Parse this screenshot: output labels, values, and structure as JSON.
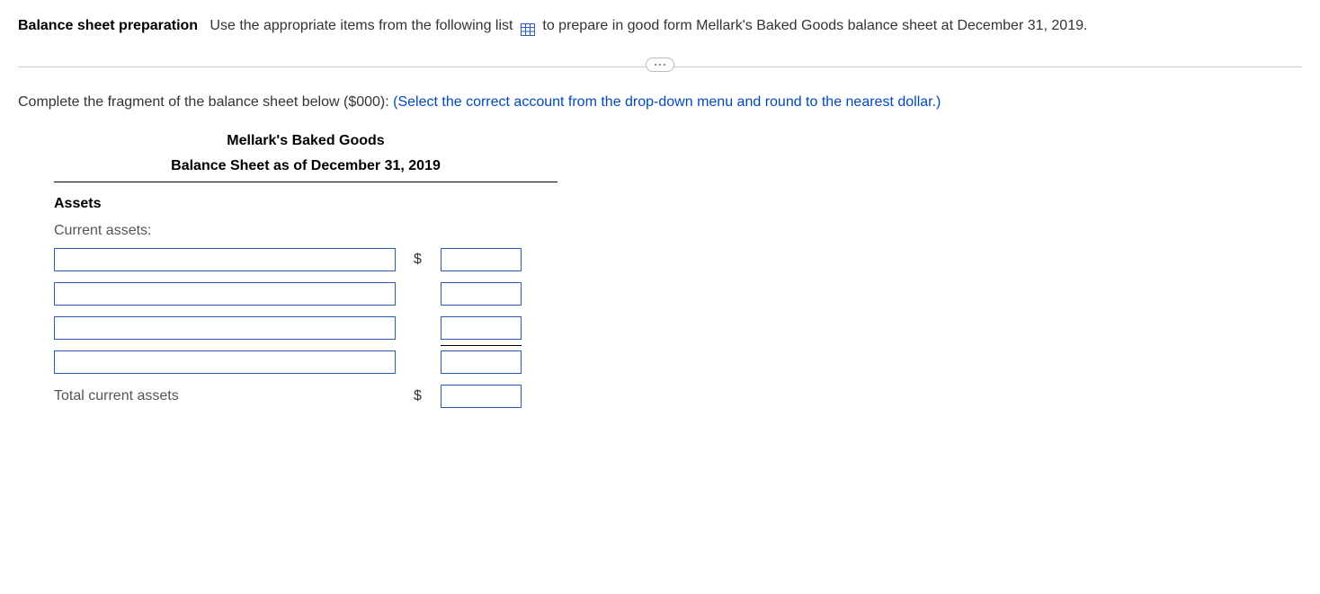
{
  "intro": {
    "bold_lead": "Balance sheet preparation",
    "text_before_icon": "Use the appropriate items from the following list",
    "text_after_icon": "to prepare in good form Mellark's  Baked Goods balance sheet at December 31, 2019."
  },
  "instruction": {
    "plain": "Complete the fragment of the balance sheet below ($000):  ",
    "blue": "(Select the correct account from the drop-down menu and round to the nearest dollar.)"
  },
  "sheet": {
    "company": "Mellark's Baked Goods",
    "title": "Balance Sheet as of December 31, 2019",
    "assets_heading": "Assets",
    "current_assets_label": "Current assets:",
    "rows": [
      {
        "account": "",
        "dollar": "$",
        "value": ""
      },
      {
        "account": "",
        "dollar": "",
        "value": ""
      },
      {
        "account": "",
        "dollar": "",
        "value": ""
      },
      {
        "account": "",
        "dollar": "",
        "value": ""
      }
    ],
    "total_label": "Total current assets",
    "total_dollar": "$",
    "total_value": ""
  }
}
